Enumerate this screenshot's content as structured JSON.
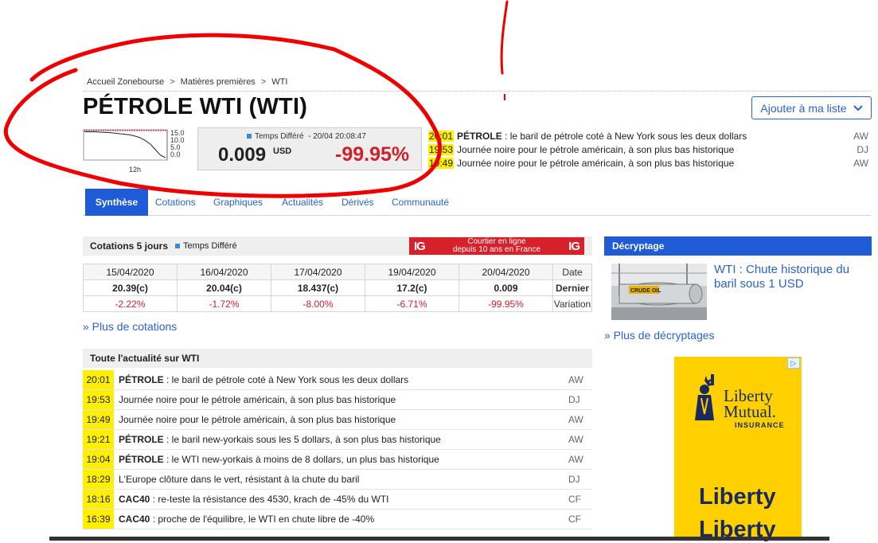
{
  "breadcrumb": [
    "Accueil Zonebourse",
    "Matières premières",
    "WTI"
  ],
  "breadcrumb_sep": ">",
  "page_title": "PÉTROLE WTI (WTI)",
  "add_list_label": "Ajouter à ma liste",
  "mini_chart": {
    "y_ticks": [
      "15.0",
      "10.0",
      "5.0",
      "0.0"
    ],
    "x_label": "12h",
    "values": [
      16.9,
      16.7,
      16.8,
      16.5,
      16.4,
      16.2,
      15.9,
      15.5,
      15.2,
      14.8,
      14.0,
      13.0,
      11.2,
      9.0,
      5.5,
      2.0,
      0.5
    ]
  },
  "quote": {
    "delay_label": "Temps Différé",
    "timestamp": "- 20/04 20:08:47",
    "price": "0.009",
    "currency": "USD",
    "change": "-99.95%"
  },
  "top_news": [
    {
      "time": "20:01",
      "bold": "PÉTROLE",
      "text": " : le baril de pétrole coté à New York sous les deux dollars",
      "src": "AW"
    },
    {
      "time": "19:53",
      "bold": "",
      "text": "Journée noire pour le pétrole américain, à son plus bas historique",
      "src": "DJ"
    },
    {
      "time": "19:49",
      "bold": "",
      "text": "Journée noire pour le pétrole américain, à son plus bas historique",
      "src": "AW"
    }
  ],
  "tabs": [
    "Synthèse",
    "Cotations",
    "Graphiques",
    "Actualités",
    "Dérivés",
    "Communauté"
  ],
  "quotes5": {
    "title": "Cotations 5 jours",
    "delay_label": "Temps Différé",
    "dates": [
      "15/04/2020",
      "16/04/2020",
      "17/04/2020",
      "19/04/2020",
      "20/04/2020"
    ],
    "last": [
      "20.39(c)",
      "20.04(c)",
      "18.437(c)",
      "17.2(c)",
      "0.009"
    ],
    "variation": [
      "-2.22%",
      "-1.72%",
      "-8.00%",
      "-6.71%",
      "-99.95%"
    ],
    "row_labels": {
      "date": "Date",
      "last": "Dernier",
      "variation": "Variation"
    }
  },
  "ig_banner": {
    "logo": "IG",
    "line1": "Courtier en ligne",
    "line2": "depuis 10 ans en France"
  },
  "more_quotes": "» Plus de cotations",
  "news_header": "Toute l'actualité sur WTI",
  "news": [
    {
      "time": "20:01",
      "bold": "PÉTROLE",
      "text": " : le baril de pétrole coté à New York sous les deux dollars",
      "src": "AW"
    },
    {
      "time": "19:53",
      "bold": "",
      "text": "Journée noire pour le pétrole américain, à son plus bas historique",
      "src": "DJ"
    },
    {
      "time": "19:49",
      "bold": "",
      "text": "Journée noire pour le pétrole américain, à son plus bas historique",
      "src": "AW"
    },
    {
      "time": "19:21",
      "bold": "PÉTROLE",
      "text": " : le baril new-yorkais sous les 5 dollars, à son plus bas historique",
      "src": "AW"
    },
    {
      "time": "19:04",
      "bold": "PÉTROLE",
      "text": " : le WTI new-yorkais à moins de 8 dollars, un plus bas historique",
      "src": "AW"
    },
    {
      "time": "18:29",
      "bold": "",
      "text": "L'Europe clôture dans le vert, résistant à la chute du baril",
      "src": "DJ"
    },
    {
      "time": "18:16",
      "bold": "CAC40",
      "text": " : re-teste la résistance des 4530, krach de -45% du WTI",
      "src": "CF"
    },
    {
      "time": "16:39",
      "bold": "CAC40",
      "text": " : proche de l'équilibre, le WTI en chute libre de -40%",
      "src": "CF"
    }
  ],
  "decrypt": {
    "header": "Décryptage",
    "title": "WTI : Chute historique du baril sous 1 USD",
    "image_caption": "CRUDE OIL",
    "more": "» Plus de décryptages"
  },
  "ad": {
    "brand_line1": "Liberty",
    "brand_line2": "Mutual.",
    "brand_sub": "INSURANCE",
    "big1": "Liberty",
    "big2": "Liberty"
  },
  "colors": {
    "accent": "#1f5bd6",
    "negative": "#d0202a",
    "highlight": "#ffef00",
    "annotation": "#ee0000"
  }
}
